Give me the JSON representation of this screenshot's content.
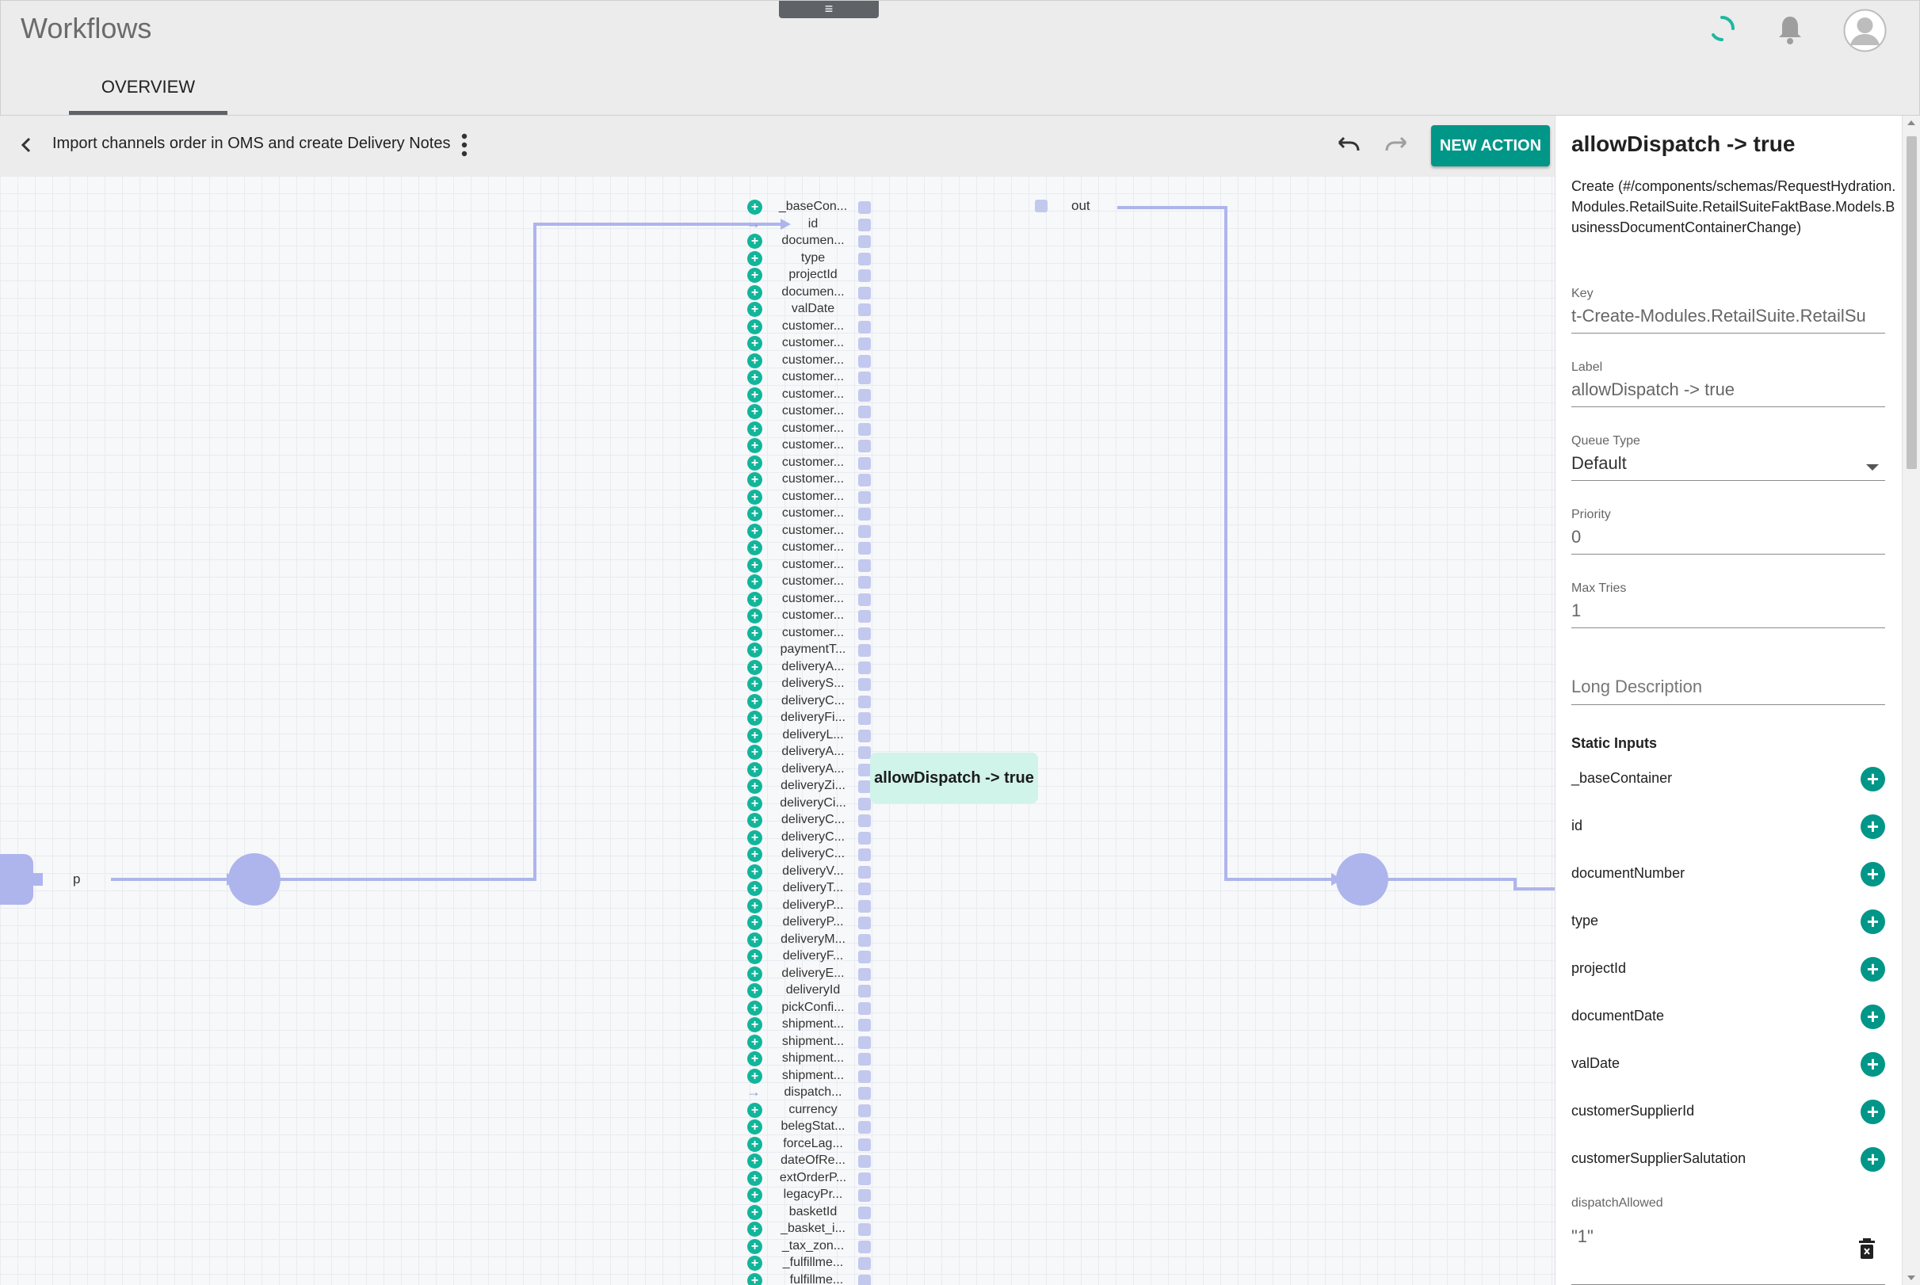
{
  "app": {
    "title": "Workflows",
    "menu_glyph": "≡"
  },
  "tabs": [
    {
      "label": "OVERVIEW"
    }
  ],
  "toolbar": {
    "workflow_name": "Import channels order in OMS and create Delivery Notes",
    "new_action_label": "NEW ACTION"
  },
  "canvas": {
    "node_label": "allowDispatch -> true",
    "out_label": "out",
    "p_label": "p",
    "ports": [
      {
        "label": "_baseCon...",
        "kind": "add"
      },
      {
        "label": "id",
        "kind": "arrow"
      },
      {
        "label": "documen...",
        "kind": "add"
      },
      {
        "label": "type",
        "kind": "add"
      },
      {
        "label": "projectId",
        "kind": "add"
      },
      {
        "label": "documen...",
        "kind": "add"
      },
      {
        "label": "valDate",
        "kind": "add"
      },
      {
        "label": "customer...",
        "kind": "add"
      },
      {
        "label": "customer...",
        "kind": "add"
      },
      {
        "label": "customer...",
        "kind": "add"
      },
      {
        "label": "customer...",
        "kind": "add"
      },
      {
        "label": "customer...",
        "kind": "add"
      },
      {
        "label": "customer...",
        "kind": "add"
      },
      {
        "label": "customer...",
        "kind": "add"
      },
      {
        "label": "customer...",
        "kind": "add"
      },
      {
        "label": "customer...",
        "kind": "add"
      },
      {
        "label": "customer...",
        "kind": "add"
      },
      {
        "label": "customer...",
        "kind": "add"
      },
      {
        "label": "customer...",
        "kind": "add"
      },
      {
        "label": "customer...",
        "kind": "add"
      },
      {
        "label": "customer...",
        "kind": "add"
      },
      {
        "label": "customer...",
        "kind": "add"
      },
      {
        "label": "customer...",
        "kind": "add"
      },
      {
        "label": "customer...",
        "kind": "add"
      },
      {
        "label": "customer...",
        "kind": "add"
      },
      {
        "label": "customer...",
        "kind": "add"
      },
      {
        "label": "paymentT...",
        "kind": "add"
      },
      {
        "label": "deliveryA...",
        "kind": "add"
      },
      {
        "label": "deliveryS...",
        "kind": "add"
      },
      {
        "label": "deliveryC...",
        "kind": "add"
      },
      {
        "label": "deliveryFi...",
        "kind": "add"
      },
      {
        "label": "deliveryL...",
        "kind": "add"
      },
      {
        "label": "deliveryA...",
        "kind": "add"
      },
      {
        "label": "deliveryA...",
        "kind": "add"
      },
      {
        "label": "deliveryZi...",
        "kind": "add"
      },
      {
        "label": "deliveryCi...",
        "kind": "add"
      },
      {
        "label": "deliveryC...",
        "kind": "add"
      },
      {
        "label": "deliveryC...",
        "kind": "add"
      },
      {
        "label": "deliveryC...",
        "kind": "add"
      },
      {
        "label": "deliveryV...",
        "kind": "add"
      },
      {
        "label": "deliveryT...",
        "kind": "add"
      },
      {
        "label": "deliveryP...",
        "kind": "add"
      },
      {
        "label": "deliveryP...",
        "kind": "add"
      },
      {
        "label": "deliveryM...",
        "kind": "add"
      },
      {
        "label": "deliveryF...",
        "kind": "add"
      },
      {
        "label": "deliveryE...",
        "kind": "add"
      },
      {
        "label": "deliveryId",
        "kind": "add"
      },
      {
        "label": "pickConfi...",
        "kind": "add"
      },
      {
        "label": "shipment...",
        "kind": "add"
      },
      {
        "label": "shipment...",
        "kind": "add"
      },
      {
        "label": "shipment...",
        "kind": "add"
      },
      {
        "label": "shipment...",
        "kind": "add"
      },
      {
        "label": "dispatch...",
        "kind": "arrow"
      },
      {
        "label": "currency",
        "kind": "add"
      },
      {
        "label": "belegStat...",
        "kind": "add"
      },
      {
        "label": "forceLag...",
        "kind": "add"
      },
      {
        "label": "dateOfRe...",
        "kind": "add"
      },
      {
        "label": "extOrderP...",
        "kind": "add"
      },
      {
        "label": "legacyPr...",
        "kind": "add"
      },
      {
        "label": "basketId",
        "kind": "add"
      },
      {
        "label": "_basket_i...",
        "kind": "add"
      },
      {
        "label": "_tax_zon...",
        "kind": "add"
      },
      {
        "label": "_fulfillme...",
        "kind": "add"
      },
      {
        "label": "_fulfillme...",
        "kind": "add"
      }
    ]
  },
  "panel": {
    "title": "allowDispatch -> true",
    "description": "Create (#/components/schemas/RequestHydration.Modules.RetailSuite.RetailSuiteFaktBase.Models.BusinessDocumentContainerChange)",
    "key_label": "Key",
    "key_value": "t-Create-Modules.RetailSuite.RetailSu",
    "label_label": "Label",
    "label_value": "allowDispatch -> true",
    "queue_type_label": "Queue Type",
    "queue_type_value": "Default",
    "priority_label": "Priority",
    "priority_value": "0",
    "max_tries_label": "Max Tries",
    "max_tries_value": "1",
    "long_description_placeholder": "Long Description",
    "static_inputs_title": "Static Inputs",
    "static_inputs": [
      "_baseContainer",
      "id",
      "documentNumber",
      "type",
      "projectId",
      "documentDate",
      "valDate",
      "customerSupplierId",
      "customerSupplierSalutation"
    ],
    "dispatch_label": "dispatchAllowed",
    "dispatch_value": "\"1\""
  },
  "colors": {
    "accent": "#009688",
    "port_add": "#12b59a",
    "connector": "#aeb5ec",
    "node_bg": "#d0f3ea"
  }
}
